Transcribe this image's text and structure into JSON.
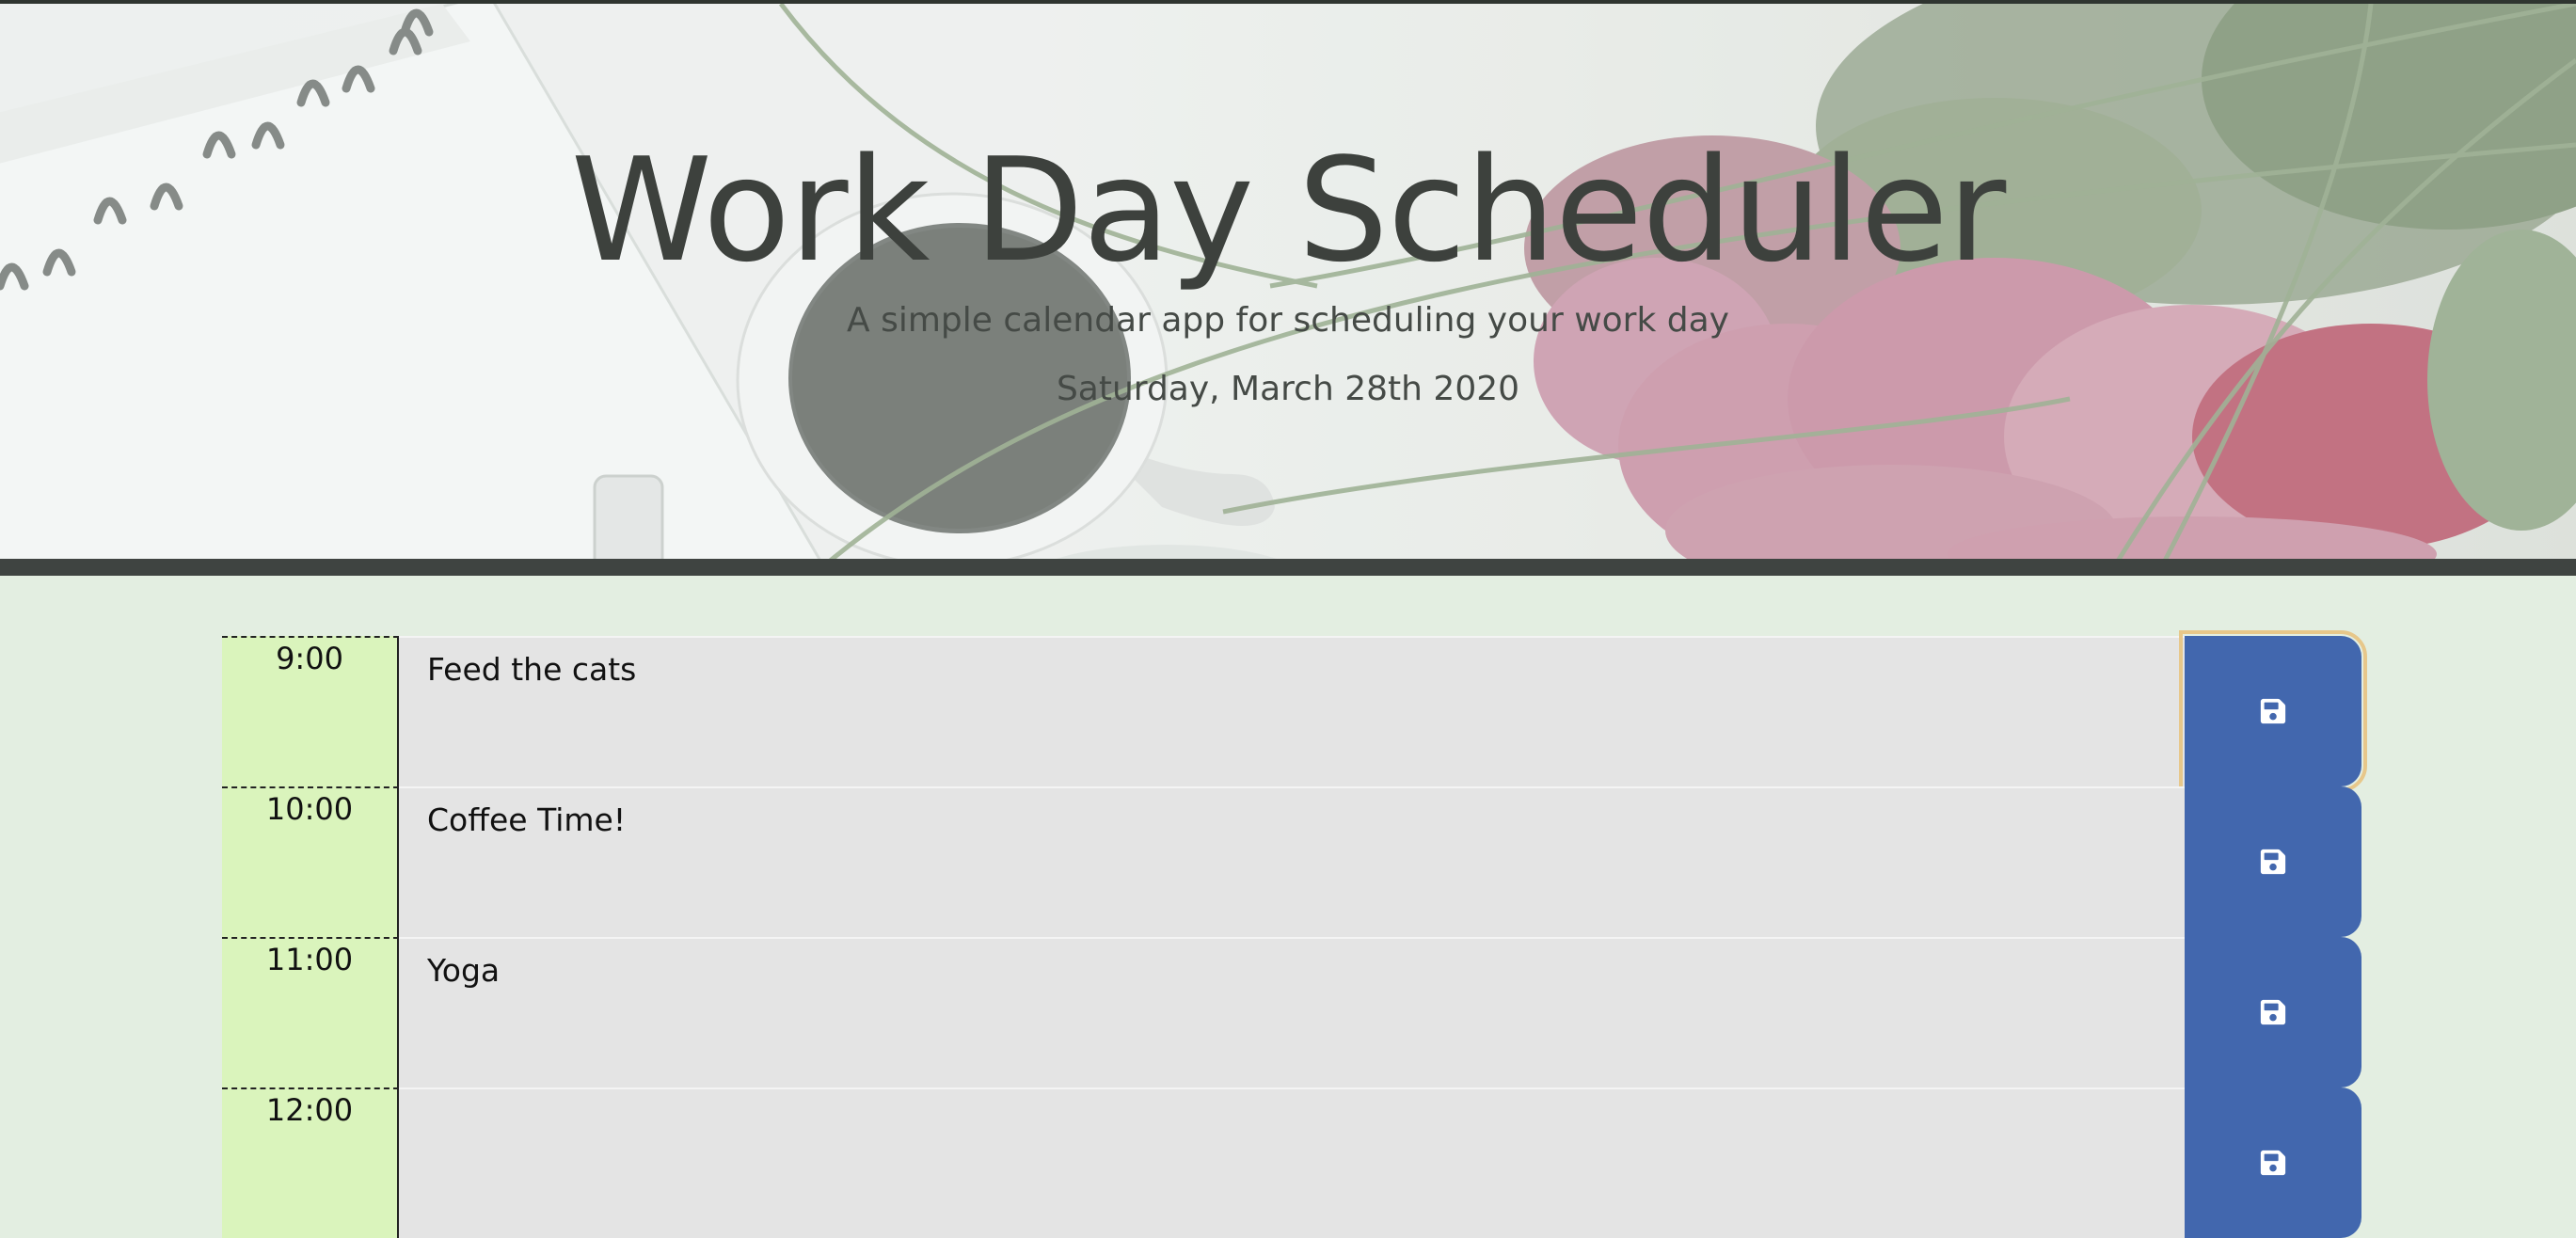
{
  "header": {
    "title": "Work Day Scheduler",
    "subtitle": "A simple calendar app for scheduling your work day",
    "current_day": "Saturday, March 28th 2020"
  },
  "colors": {
    "page_background": "#e3eee1",
    "hour_background": "#daf4bc",
    "description_background": "#e4e4e4",
    "save_button": "#4267ae",
    "header_bar": "#3f4441"
  },
  "time_blocks": [
    {
      "hour": "9:00",
      "description": "Feed the cats",
      "save_icon": "floppy-disk-icon"
    },
    {
      "hour": "10:00",
      "description": "Coffee Time!",
      "save_icon": "floppy-disk-icon"
    },
    {
      "hour": "11:00",
      "description": "Yoga",
      "save_icon": "floppy-disk-icon"
    },
    {
      "hour": "12:00",
      "description": "",
      "save_icon": "floppy-disk-icon"
    }
  ]
}
